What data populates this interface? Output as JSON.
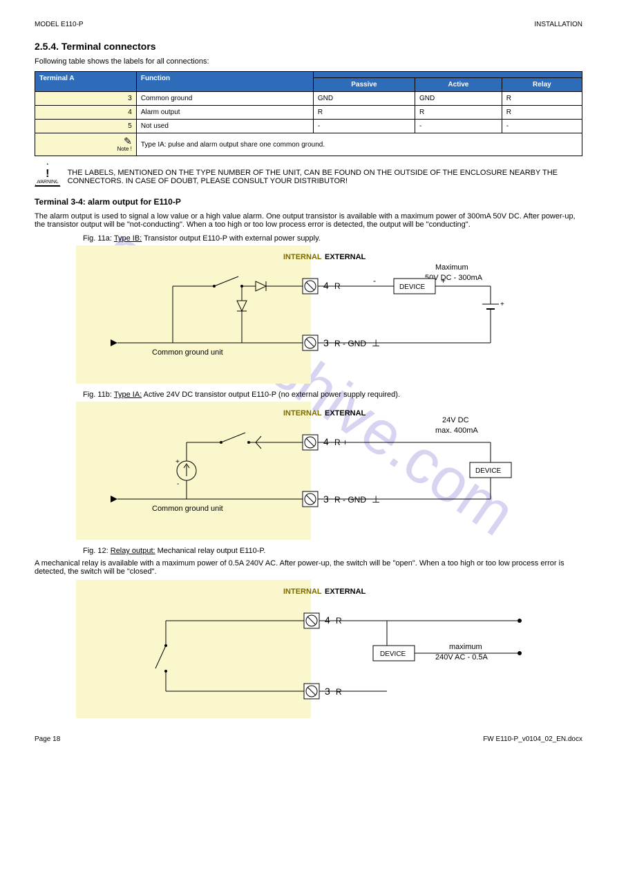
{
  "header": {
    "left": "MODEL E110-P",
    "right": "INSTALLATION"
  },
  "section": {
    "number_title": "2.5.4.   Terminal connectors",
    "intro": "Following table shows the labels for all connections:"
  },
  "table": {
    "head": {
      "terminal": "Terminal A",
      "function": "Function",
      "passive": "Passive",
      "active": "Active",
      "relay": "Relay"
    },
    "rows": [
      {
        "label": "3",
        "func": "Common ground",
        "passive": "GND",
        "active": "GND",
        "relay": "R"
      },
      {
        "label": "4",
        "func": "Alarm output",
        "passive": "R",
        "active": "R",
        "relay": "R"
      },
      {
        "label": "5",
        "func": "Not used",
        "passive": "-",
        "active": "-",
        "relay": "-"
      }
    ],
    "note_text": "Type IA: pulse and alarm output share one common ground."
  },
  "warning_text": "THE LABELS, MENTIONED ON THE TYPE NUMBER OF THE UNIT, CAN BE FOUND ON THE OUTSIDE OF THE ENCLOSURE NEARBY THE CONNECTORS. IN CASE OF DOUBT, PLEASE CONSULT YOUR DISTRIBUTOR!",
  "subsection": {
    "title": "Terminal 3-4: alarm output for E110-P",
    "desc": "The alarm output is used to signal a low value or a high value alarm. One output transistor is available with a maximum power of 300mA 50V DC. After power-up, the transistor output will be \"not-conducting\". When a too high or too low process error is detected, the output will be \"conducting\"."
  },
  "fig_a": {
    "prefix": "Fig. 11a:",
    "type": "Type IB:",
    "rest": "Transistor output E110-P with external power supply.",
    "internal": "INTERNAL",
    "external": "EXTERNAL",
    "pin4": "4",
    "pin4_label": "R",
    "minus": "-",
    "device": "DEVICE",
    "plus": "+",
    "max_line1": "Maximum",
    "max_line2": "50V DC - 300mA",
    "common": "Common ground unit",
    "pin3": "3",
    "pin3_label": "R - GND",
    "gnd_sym": "⊥"
  },
  "fig_b": {
    "prefix": "Fig. 11b:",
    "type": "Type IA:",
    "rest": "Active 24V DC transistor output E110-P (no external power supply required).",
    "internal": "INTERNAL",
    "external": "EXTERNAL",
    "pin4": "4",
    "pin4_label": "R +",
    "volt_line1": "24V DC",
    "volt_line2": "max. 400mA",
    "device": "DEVICE",
    "plus": "+",
    "minus": "-",
    "common": "Common ground unit",
    "pin3": "3",
    "pin3_label": "R - GND",
    "gnd_sym": "⊥"
  },
  "relay": {
    "prefix": "Fig. 12:",
    "type": "Relay output:",
    "rest": "Mechanical relay output E110-P.",
    "intro": "A mechanical relay is available with a maximum power of 0.5A 240V AC. After power-up, the switch will be \"open\". When a too high or too low process error is detected, the switch will be \"closed\".",
    "internal": "INTERNAL",
    "external": "EXTERNAL",
    "pin4": "4",
    "pin4_label": "R",
    "device": "DEVICE",
    "max_line1": "maximum",
    "max_line2": "240V AC - 0.5A",
    "pin3": "3",
    "pin3_label": "R"
  },
  "footer": {
    "left": "Page 18",
    "right": "FW E110-P_v0104_02_EN.docx"
  },
  "watermark": "manualshive.com"
}
